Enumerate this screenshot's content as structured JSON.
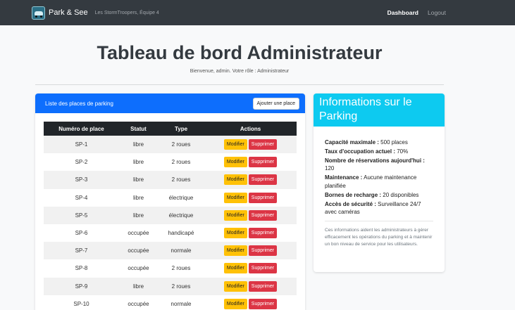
{
  "nav": {
    "brand": "Park & See",
    "tagline": "Les StormTroopers, Équipe 4",
    "logo_icon": "parking-car-logo-icon",
    "links": [
      {
        "label": "Dashboard",
        "active": true
      },
      {
        "label": "Logout",
        "active": false
      }
    ]
  },
  "header": {
    "title": "Tableau de bord Administrateur",
    "subtitle": "Bienvenue, admin. Votre rôle : Administrateur"
  },
  "parking_list": {
    "title": "Liste des places de parking",
    "add_label": "Ajouter une place",
    "columns": [
      "Numéro de place",
      "Statut",
      "Type",
      "Actions"
    ],
    "edit_label": "Modifier",
    "delete_label": "Supprimer",
    "rows": [
      {
        "numero": "SP-1",
        "statut": "libre",
        "type": "2 roues"
      },
      {
        "numero": "SP-2",
        "statut": "libre",
        "type": "2 roues"
      },
      {
        "numero": "SP-3",
        "statut": "libre",
        "type": "2 roues"
      },
      {
        "numero": "SP-4",
        "statut": "libre",
        "type": "électrique"
      },
      {
        "numero": "SP-5",
        "statut": "libre",
        "type": "électrique"
      },
      {
        "numero": "SP-6",
        "statut": "occupée",
        "type": "handicapé"
      },
      {
        "numero": "SP-7",
        "statut": "occupée",
        "type": "normale"
      },
      {
        "numero": "SP-8",
        "statut": "occupée",
        "type": "2 roues"
      },
      {
        "numero": "SP-9",
        "statut": "libre",
        "type": "2 roues"
      },
      {
        "numero": "SP-10",
        "statut": "occupée",
        "type": "normale"
      }
    ]
  },
  "info": {
    "title": "Informations sur le Parking",
    "items": [
      {
        "label": "Capacité maximale :",
        "value": "500 places"
      },
      {
        "label": "Taux d'occupation actuel :",
        "value": "70%"
      },
      {
        "label": "Nombre de réservations aujourd'hui :",
        "value": "120"
      },
      {
        "label": "Maintenance :",
        "value": "Aucune maintenance planifiée"
      },
      {
        "label": "Bornes de recharge :",
        "value": "20 disponibles"
      },
      {
        "label": "Accès de sécurité :",
        "value": "Surveillance 24/7 avec caméras"
      }
    ],
    "note": "Ces informations aident les administrateurs à gérer efficacement les opérations du parking et à maintenir un bon niveau de service pour les utilisateurs."
  },
  "colors": {
    "navbar": "#343a40",
    "primary": "#0d6efd",
    "info": "#0dcaf0",
    "warning": "#ffc107",
    "danger": "#dc3545"
  }
}
